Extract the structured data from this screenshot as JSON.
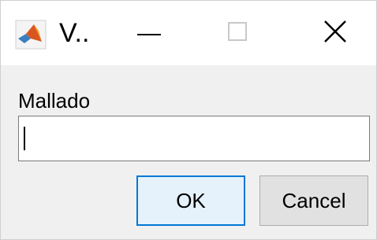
{
  "window": {
    "title": "V..",
    "accent_color": "#0078d7",
    "app_icon": "matlab-icon",
    "controls": {
      "minimize_icon": "minimize-icon",
      "maximize_icon": "maximize-icon",
      "close_icon": "close-icon"
    }
  },
  "form": {
    "label": "Mallado",
    "input_value": "",
    "input_placeholder": ""
  },
  "buttons": {
    "ok_label": "OK",
    "cancel_label": "Cancel"
  }
}
